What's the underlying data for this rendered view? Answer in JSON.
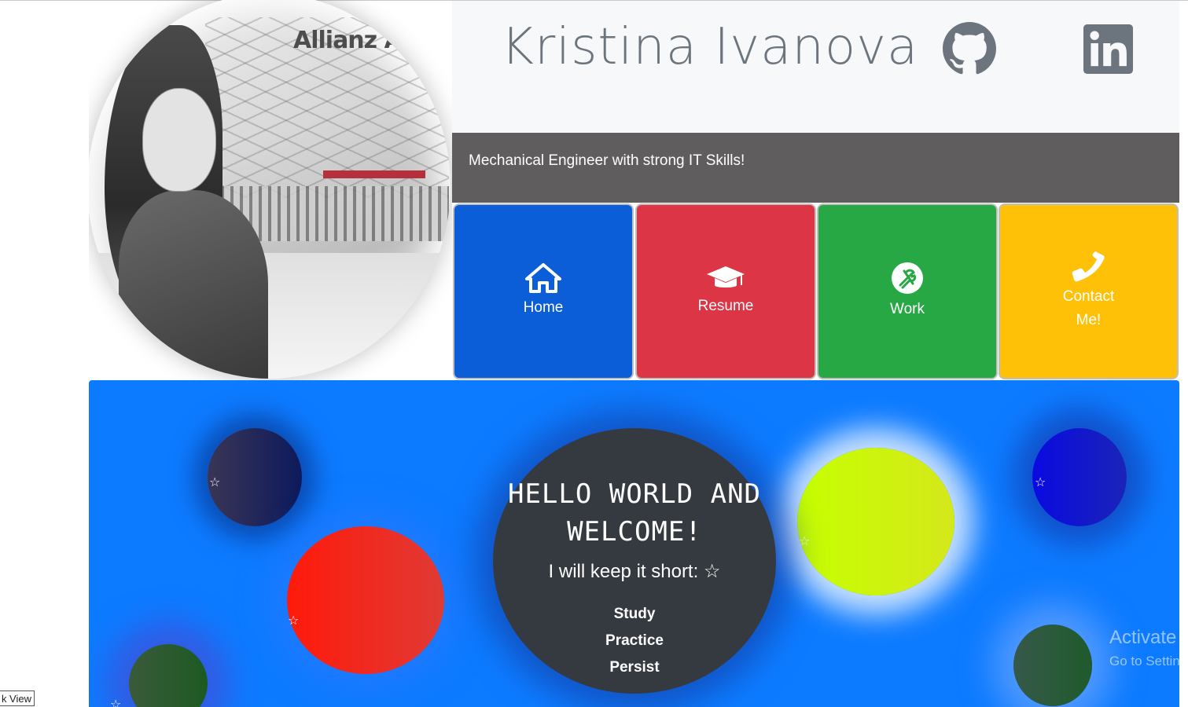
{
  "header": {
    "name": "Kristina Ivanova",
    "subtitle": "Mechanical Engineer with strong IT Skills!",
    "photo_sign_text": "Allianz Are",
    "social": [
      "github-icon",
      "linkedin-icon"
    ]
  },
  "nav": {
    "home": "Home",
    "resume": "Resume",
    "work": "Work",
    "contact_line1": "Contact",
    "contact_line2": "Me!"
  },
  "hero": {
    "hello_line1": "HELLO WORLD AND",
    "hello_line2": "WELCOME!",
    "short": "I will keep it short: ☆",
    "steps": [
      "Study",
      "Practice",
      "Persist"
    ],
    "star": "☆"
  },
  "overlay": {
    "activate": "Activate W",
    "go_to_settings": "Go to Setting",
    "bottom_left": "k View"
  },
  "colors": {
    "home": "#0b5ed7",
    "resume": "#dc3545",
    "work": "#28a745",
    "contact": "#ffc107",
    "hero_bg": "#0d7bff",
    "subtitle_bg": "#5f5d5e"
  }
}
